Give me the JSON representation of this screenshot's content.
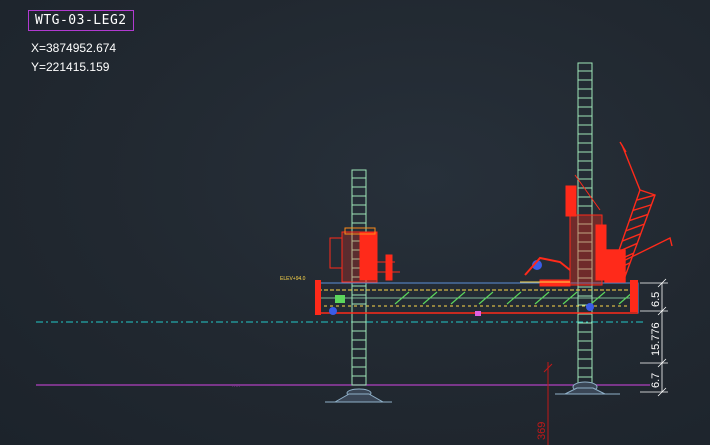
{
  "drawing": {
    "title": "WTG-03-LEG2",
    "coord_x": "X=3874952.674",
    "coord_y": "Y=221415.159"
  },
  "dimensions": {
    "top": "6.5",
    "middle": "15.776",
    "bottom": "6.7",
    "red_vertical": "369"
  },
  "colors": {
    "background": "#212830",
    "leg": "#9fe6b8",
    "vessel": "#ff2a1a",
    "accent_magenta": "#b13ad0",
    "waterline": "#22c8c8",
    "seabed": "#b040c0"
  }
}
